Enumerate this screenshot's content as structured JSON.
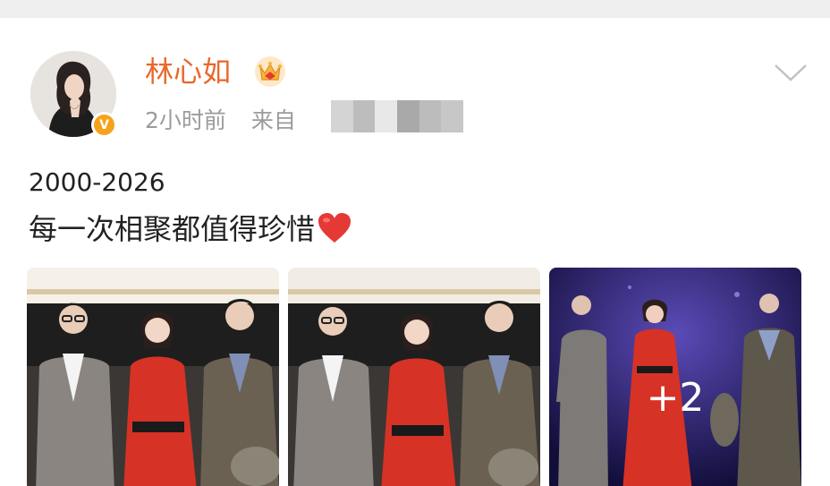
{
  "post": {
    "author": {
      "name": "林心如",
      "verified_badge": "V",
      "avatar_icon": "avatar-portrait",
      "crown_icon": "crown-icon"
    },
    "meta": {
      "time": "2小时前",
      "source_label": "来自"
    },
    "text": {
      "line1": "2000-2026",
      "line2": "每一次相聚都值得珍惜"
    },
    "emoji": "heart-icon",
    "images": {
      "more_count": "+2"
    }
  },
  "colors": {
    "username": "#e8682a",
    "meta": "#9b9b9b",
    "badge": "#f5a21c",
    "heart": "#e53935",
    "dress": "#d63226",
    "stage": "#2a2470"
  }
}
